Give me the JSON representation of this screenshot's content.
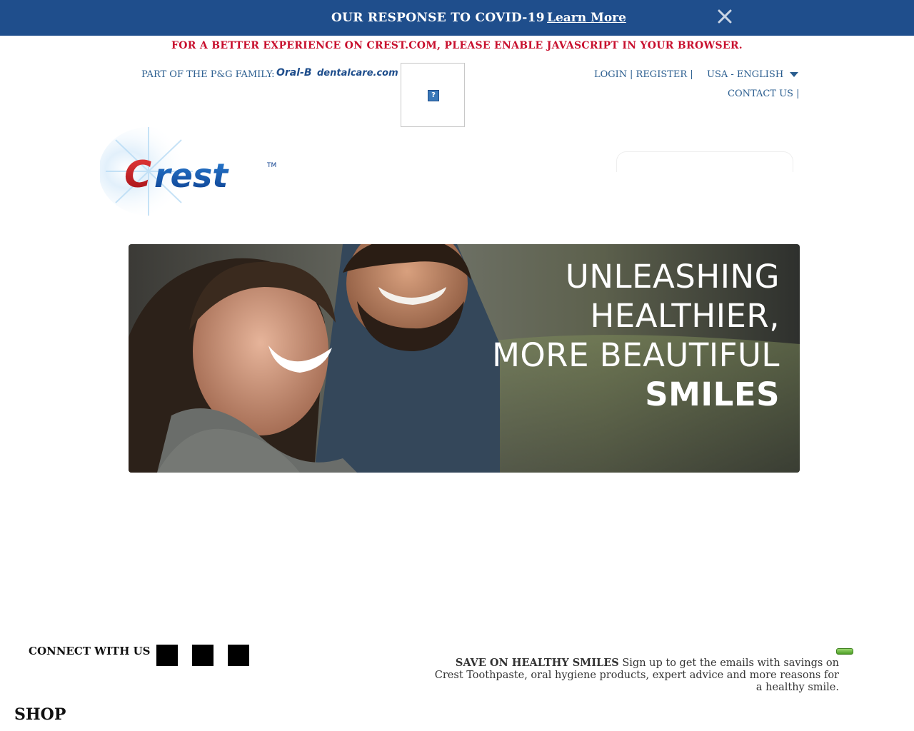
{
  "covid_banner": {
    "message": "OUR RESPONSE TO COVID-19",
    "link_label": "Learn More",
    "close_icon": "close-icon",
    "background_color": "#1f4e8c"
  },
  "notice": {
    "js_warning": "FOR A BETTER EXPERIENCE ON CREST.COM, PLEASE ENABLE JAVASCRIPT IN YOUR BROWSER.",
    "color": "#c8102e"
  },
  "family": {
    "label": "PART OF THE P&G FAMILY:",
    "brands": [
      "Oral-B",
      "dentalcare.com"
    ],
    "broken_image_icon": "broken-image-icon"
  },
  "utility_nav": {
    "login": "LOGIN",
    "register": "REGISTER",
    "language": "USA - ENGLISH",
    "contact": "CONTACT US"
  },
  "brand": {
    "logo_text": "Crest",
    "trademark": "TM"
  },
  "hero": {
    "lines": [
      "UNLEASHING",
      "HEALTHIER,",
      "MORE BEAUTIFUL"
    ],
    "emphasis": "SMILES"
  },
  "footer": {
    "connect_label": "CONNECT WITH US",
    "social_icons": [
      "social-icon-1",
      "social-icon-2",
      "social-icon-3"
    ],
    "signup_title": "SAVE ON HEALTHY SMILES",
    "signup_body": "Sign up to get the emails with savings on Crest Toothpaste, oral hygiene products, expert advice and more reasons for a healthy smile.",
    "shop_heading": "SHOP"
  }
}
